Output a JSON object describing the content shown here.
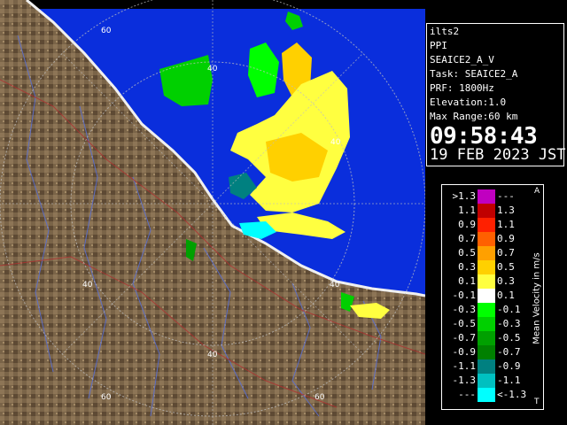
{
  "radar": {
    "range_labels": [
      "60",
      "40",
      "40",
      "40",
      "40",
      "40",
      "60",
      "60"
    ],
    "colors": {
      "sea": "#0a2edc",
      "land": "#7a6448",
      "coast": "#f0f0f0",
      "outer": "#000000"
    }
  },
  "info": {
    "station": "ilts2",
    "mode": "PPI",
    "product": "SEAICE2_A_V",
    "task": "Task: SEAICE2_A",
    "prf": "PRF: 1800Hz",
    "elevation": "Elevation:1.0",
    "max_range": "Max Range:60 km",
    "time": "09:58:43",
    "date": "19 FEB 2023 JST"
  },
  "legend": {
    "title": "Mean Velocity in m/s",
    "top_marker": "A",
    "bottom_marker": "T",
    "rows": [
      {
        "left": ">1.3",
        "right": "---",
        "color": "#c000c0"
      },
      {
        "left": "1.1",
        "right": "1.3",
        "color": "#c00000"
      },
      {
        "left": "0.9",
        "right": "1.1",
        "color": "#ff2000"
      },
      {
        "left": "0.7",
        "right": "0.9",
        "color": "#ff6000"
      },
      {
        "left": "0.5",
        "right": "0.7",
        "color": "#ffa000"
      },
      {
        "left": "0.3",
        "right": "0.5",
        "color": "#ffd000"
      },
      {
        "left": "0.1",
        "right": "0.3",
        "color": "#ffff40"
      },
      {
        "left": "-0.1",
        "right": "0.1",
        "color": "#ffffff"
      },
      {
        "left": "-0.3",
        "right": "-0.1",
        "color": "#00ff00"
      },
      {
        "left": "-0.5",
        "right": "-0.3",
        "color": "#00d000"
      },
      {
        "left": "-0.7",
        "right": "-0.5",
        "color": "#00a000"
      },
      {
        "left": "-0.9",
        "right": "-0.7",
        "color": "#008000"
      },
      {
        "left": "-1.1",
        "right": "-0.9",
        "color": "#008080"
      },
      {
        "left": "-1.3",
        "right": "-1.1",
        "color": "#00c0c0"
      },
      {
        "left": "---",
        "right": "<-1.3",
        "color": "#00ffff"
      }
    ]
  }
}
